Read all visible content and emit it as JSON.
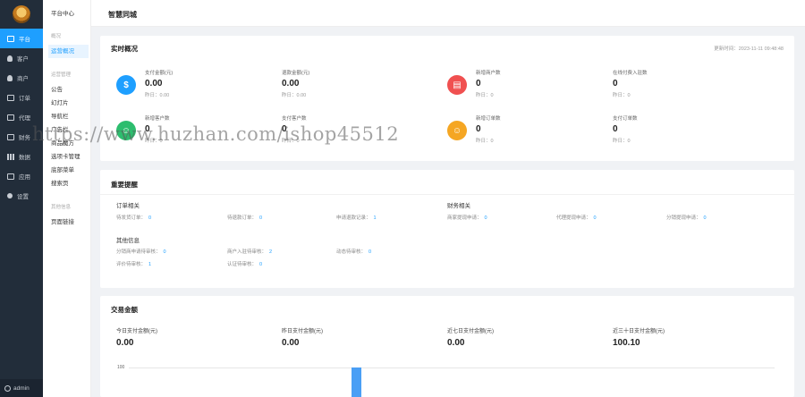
{
  "rail": {
    "items": [
      {
        "label": "平台",
        "icon": "monitor-icon"
      },
      {
        "label": "客户",
        "icon": "user-icon"
      },
      {
        "label": "商户",
        "icon": "users-icon"
      },
      {
        "label": "订单",
        "icon": "list-icon"
      },
      {
        "label": "代理",
        "icon": "flag-icon"
      },
      {
        "label": "财务",
        "icon": "wallet-icon"
      },
      {
        "label": "数据",
        "icon": "chart-icon"
      },
      {
        "label": "应用",
        "icon": "apps-icon"
      },
      {
        "label": "设置",
        "icon": "gear-icon"
      }
    ],
    "user": "admin"
  },
  "subnav": {
    "head": "平台中心",
    "group1": "概况",
    "overview": "运营概况",
    "group2": "运营管理",
    "items": [
      "公告",
      "幻灯片",
      "导航栏",
      "广告栏",
      "商品魔方",
      "选项卡管理",
      "底部菜单",
      "搜索页"
    ],
    "group3": "其他信息",
    "page_links": "页面链接"
  },
  "topbar": {
    "title": "智慧同城"
  },
  "realtime": {
    "title": "实时概况",
    "updated": "更新时间：2023-11-11 09:48:48",
    "stats": [
      {
        "label": "支付金额(元)",
        "value": "0.00",
        "yesterday": "昨日：0.00",
        "icon": "money-bag-icon",
        "color": "#1e9fff"
      },
      {
        "label": "退款金额(元)",
        "value": "0.00",
        "yesterday": "昨日：0.00"
      },
      {
        "label": "新增商户数",
        "value": "0",
        "yesterday": "昨日：0",
        "icon": "store-icon",
        "color": "#f05050"
      },
      {
        "label": "在线付费入驻数",
        "value": "0",
        "yesterday": "昨日：0"
      },
      {
        "label": "新增客户数",
        "value": "0",
        "yesterday": "昨日：0",
        "icon": "users-icon",
        "color": "#2dbd6e"
      },
      {
        "label": "支付客户数",
        "value": "0",
        "yesterday": "昨日：0"
      },
      {
        "label": "新增订单数",
        "value": "0",
        "yesterday": "昨日：0",
        "icon": "order-icon",
        "color": "#f5a623"
      },
      {
        "label": "支付订单数",
        "value": "0",
        "yesterday": "昨日：0"
      }
    ]
  },
  "reminders": {
    "title": "重要提醒",
    "orders_label": "订单相关",
    "finance_label": "财务相关",
    "other_label": "其他信息",
    "orders": [
      {
        "label": "待发货订单：",
        "value": "0"
      },
      {
        "label": "待退款订单：",
        "value": "0"
      },
      {
        "label": "申请退款记录：",
        "value": "1"
      }
    ],
    "finance": [
      {
        "label": "商家提现申请：",
        "value": "0"
      },
      {
        "label": "代理提现申请：",
        "value": "0"
      },
      {
        "label": "分销提现申请：",
        "value": "0"
      }
    ],
    "other": [
      {
        "label": "分销商申请待审核：",
        "value": "0"
      },
      {
        "label": "商户入驻待审核：",
        "value": "2"
      },
      {
        "label": "动态待审核：",
        "value": "0"
      },
      {
        "label": "评价待审核：",
        "value": "1"
      },
      {
        "label": "认证待审核：",
        "value": "0"
      }
    ]
  },
  "trade": {
    "title": "交易金额",
    "items": [
      {
        "label": "今日支付金额(元)",
        "value": "0.00"
      },
      {
        "label": "昨日支付金额(元)",
        "value": "0.00"
      },
      {
        "label": "近七日支付金额(元)",
        "value": "0.00"
      },
      {
        "label": "近三十日支付金额(元)",
        "value": "100.10"
      }
    ]
  },
  "chart_data": {
    "type": "bar",
    "y_ticks": [
      "100"
    ],
    "ylim": [
      0,
      100
    ],
    "values": [
      100
    ],
    "color": "#4a9ff5"
  },
  "watermark": "https://www.huzhan.com/ishop45512"
}
